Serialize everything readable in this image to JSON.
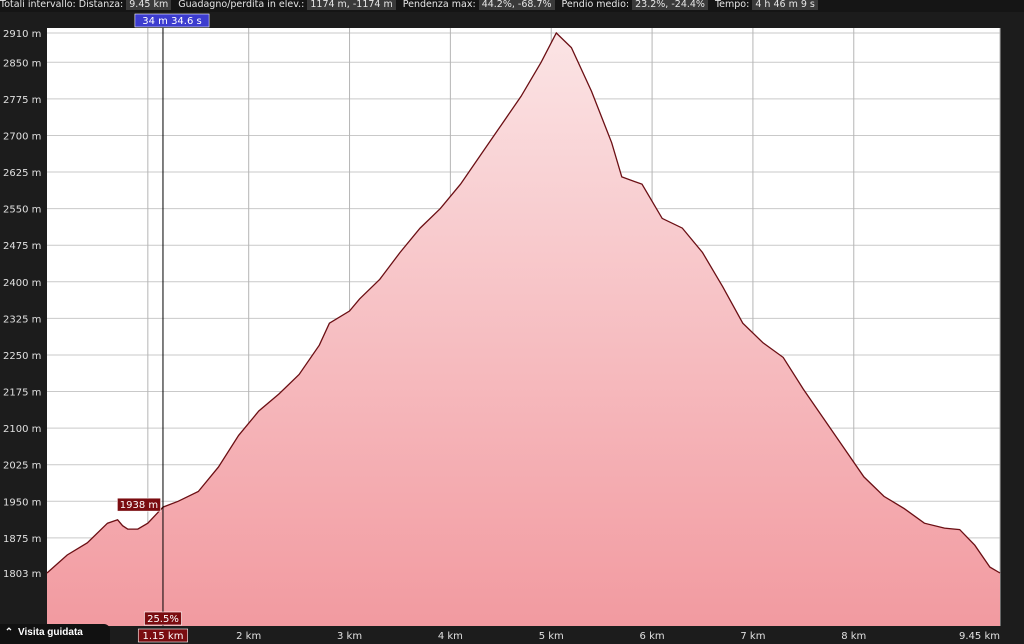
{
  "stats": {
    "title": "Totali intervallo:",
    "distance_label": "Distanza:",
    "distance": "9.45 km",
    "gain_label": "Guadagno/perdita in elev.:",
    "gain": "1174 m, -1174 m",
    "max_slope_label": "Pendenza max:",
    "max_slope": "44.2%, -68.7%",
    "avg_slope_label": "Pendio medio:",
    "avg_slope": "23.2%, -24.4%",
    "time_label": "Tempo:",
    "time": "4 h 46 m 9 s"
  },
  "cursor": {
    "time_label": "34 m 34.6 s",
    "elevation_label": "1938 m",
    "slope_label": "25.5%",
    "distance_label": "1.15 km",
    "distance_km": 1.15,
    "elevation_m": 1938
  },
  "guided_tour": {
    "label": "Visita guidata",
    "icon": "chevron-up-icon"
  },
  "colors": {
    "fill_top": "#fbe4e5",
    "fill_bottom": "#f29aa0",
    "line": "#6b0f14",
    "label_bg": "#7a0c10",
    "time_bg": "#3c3ccf"
  },
  "chart_data": {
    "type": "area",
    "title": "",
    "xlabel": "",
    "ylabel": "",
    "x_unit": "km",
    "y_unit": "m",
    "xlim": [
      0,
      9.45
    ],
    "ylim": [
      1785,
      2915
    ],
    "x_ticks": [
      2,
      3,
      4,
      5,
      6,
      7,
      8,
      9.45
    ],
    "x_tick_labels": [
      "2 km",
      "3 km",
      "4 km",
      "5 km",
      "6 km",
      "7 km",
      "8 km",
      "9.45 km"
    ],
    "y_ticks": [
      1803,
      1875,
      1950,
      2025,
      2100,
      2175,
      2250,
      2325,
      2400,
      2475,
      2550,
      2625,
      2700,
      2775,
      2850,
      2910
    ],
    "y_tick_labels": [
      "1803 m",
      "1875 m",
      "1950 m",
      "2025 m",
      "2100 m",
      "2175 m",
      "2250 m",
      "2325 m",
      "2400 m",
      "2475 m",
      "2550 m",
      "2625 m",
      "2700 m",
      "2775 m",
      "2850 m",
      "2910 m"
    ],
    "grid": true,
    "series": [
      {
        "x": [
          0,
          0.2,
          0.4,
          0.6,
          0.7,
          0.75,
          0.8,
          0.9,
          1.0,
          1.15,
          1.3,
          1.5,
          1.7,
          1.9,
          2.1,
          2.3,
          2.5,
          2.7,
          2.8,
          3.0,
          3.1,
          3.3,
          3.5,
          3.7,
          3.9,
          4.1,
          4.3,
          4.5,
          4.7,
          4.9,
          5.05,
          5.2,
          5.4,
          5.6,
          5.7,
          5.9,
          6.1,
          6.3,
          6.5,
          6.7,
          6.9,
          7.1,
          7.3,
          7.5,
          7.7,
          7.9,
          8.1,
          8.3,
          8.5,
          8.7,
          8.9,
          9.05,
          9.2,
          9.35,
          9.45
        ],
        "y": [
          1803,
          1840,
          1865,
          1905,
          1912,
          1900,
          1893,
          1893,
          1905,
          1938,
          1950,
          1970,
          2020,
          2085,
          2135,
          2170,
          2210,
          2270,
          2315,
          2340,
          2365,
          2405,
          2460,
          2510,
          2550,
          2600,
          2660,
          2720,
          2780,
          2850,
          2910,
          2880,
          2790,
          2685,
          2615,
          2600,
          2530,
          2510,
          2460,
          2390,
          2315,
          2275,
          2245,
          2180,
          2120,
          2060,
          2000,
          1960,
          1935,
          1905,
          1895,
          1892,
          1860,
          1815,
          1803
        ]
      }
    ]
  }
}
